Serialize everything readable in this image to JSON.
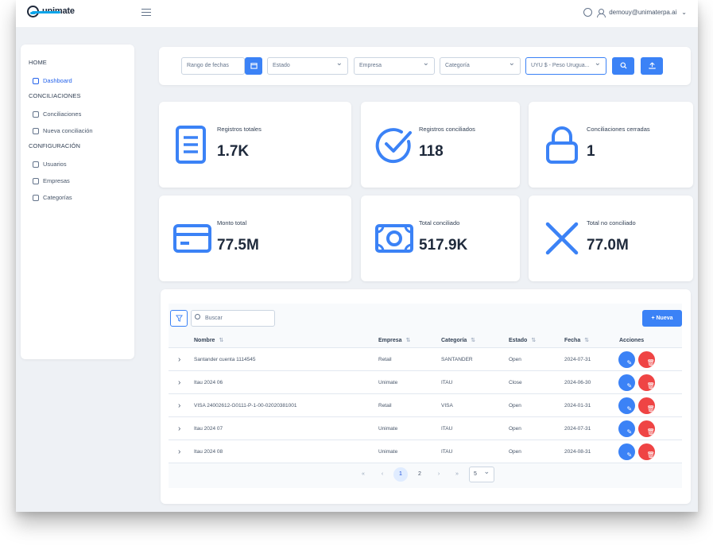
{
  "app": {
    "brand": "unimate",
    "user_email": "demouy@unimaterpa.ai"
  },
  "sidebar": {
    "sections": [
      {
        "title": "HOME",
        "items": [
          {
            "label": "Dashboard",
            "icon": "home-icon",
            "active": true
          }
        ]
      },
      {
        "title": "CONCILIACIONES",
        "items": [
          {
            "label": "Conciliaciones",
            "icon": "copy-icon"
          },
          {
            "label": "Nueva conciliación",
            "icon": "file-icon"
          }
        ]
      },
      {
        "title": "CONFIGURACIÓN",
        "items": [
          {
            "label": "Usuarios",
            "icon": "users-icon"
          },
          {
            "label": "Empresas",
            "icon": "building-icon"
          },
          {
            "label": "Categorías",
            "icon": "tag-icon"
          }
        ]
      }
    ]
  },
  "filters": {
    "date_range_placeholder": "Rango de fechas",
    "estado_placeholder": "Estado",
    "empresa_placeholder": "Empresa",
    "categoria_placeholder": "Categoría",
    "currency_value": "UYU $ - Peso Urugua..."
  },
  "stats": [
    {
      "label": "Registros totales",
      "value": "1.7K",
      "icon": "document-icon"
    },
    {
      "label": "Registros conciliados",
      "value": "118",
      "icon": "check-circle-icon"
    },
    {
      "label": "Conciliaciones cerradas",
      "value": "1",
      "icon": "lock-icon"
    },
    {
      "label": "Monto total",
      "value": "77.5M",
      "icon": "credit-card-icon"
    },
    {
      "label": "Total conciliado",
      "value": "517.9K",
      "icon": "money-icon"
    },
    {
      "label": "Total no conciliado",
      "value": "77.0M",
      "icon": "x-icon"
    }
  ],
  "table": {
    "search_placeholder": "Buscar",
    "new_button": "+ Nueva",
    "columns": [
      "Nombre",
      "Empresa",
      "Categoría",
      "Estado",
      "Fecha",
      "Acciones"
    ],
    "rows": [
      {
        "nombre": "Santander cuenta 1114545",
        "empresa": "Retail",
        "categoria": "SANTANDER",
        "estado": "Open",
        "fecha": "2024-07-31"
      },
      {
        "nombre": "Itau 2024 06",
        "empresa": "Unimate",
        "categoria": "ITAU",
        "estado": "Close",
        "fecha": "2024-06-30"
      },
      {
        "nombre": "VISA 24002612-G0111-P-1-00-02020381001",
        "empresa": "Retail",
        "categoria": "VISA",
        "estado": "Open",
        "fecha": "2024-01-31"
      },
      {
        "nombre": "Itau 2024 07",
        "empresa": "Unimate",
        "categoria": "ITAU",
        "estado": "Open",
        "fecha": "2024-07-31"
      },
      {
        "nombre": "Itau 2024 08",
        "empresa": "Unimate",
        "categoria": "ITAU",
        "estado": "Open",
        "fecha": "2024-08-31"
      }
    ],
    "pagination": {
      "first": "«",
      "prev": "‹",
      "pages": [
        "1",
        "2"
      ],
      "current": "1",
      "next": "›",
      "last": "»",
      "page_size": "5"
    }
  },
  "colors": {
    "primary": "#3b82f6",
    "danger": "#ef4444",
    "background": "#eef1f5"
  }
}
